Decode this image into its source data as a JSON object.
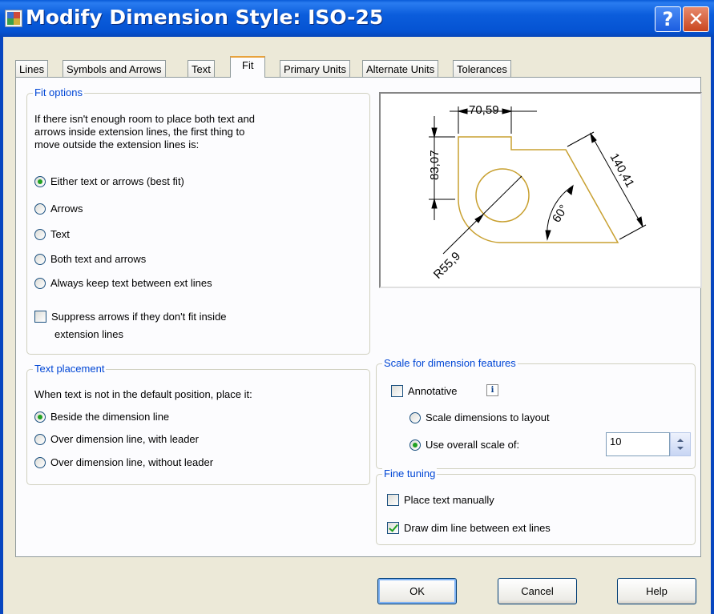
{
  "window": {
    "title": "Modify Dimension Style: ISO-25",
    "help_glyph": "?",
    "close_glyph": "✕"
  },
  "tabs": [
    {
      "label": "Lines"
    },
    {
      "label": "Symbols and Arrows"
    },
    {
      "label": "Text"
    },
    {
      "label": "Fit"
    },
    {
      "label": "Primary Units"
    },
    {
      "label": "Alternate Units"
    },
    {
      "label": "Tolerances"
    }
  ],
  "active_tab": "Fit",
  "fit_options": {
    "legend": "Fit options",
    "description": [
      "If there isn't enough room to place both text and",
      "arrows inside extension lines, the first thing to",
      "move outside the extension lines is:"
    ],
    "options": [
      {
        "label": "Either text or arrows (best fit)",
        "selected": true
      },
      {
        "label": "Arrows",
        "selected": false
      },
      {
        "label": "Text",
        "selected": false
      },
      {
        "label": "Both text and arrows",
        "selected": false
      },
      {
        "label": "Always keep text between ext lines",
        "selected": false
      }
    ],
    "suppress": {
      "line1": "Suppress arrows if they don't fit inside",
      "line2": "extension lines",
      "checked": false
    }
  },
  "text_placement": {
    "legend": "Text placement",
    "description": "When text is not in the default position, place it:",
    "options": [
      {
        "label": "Beside the dimension line",
        "selected": true
      },
      {
        "label": "Over dimension line, with leader",
        "selected": false
      },
      {
        "label": "Over dimension line, without leader",
        "selected": false
      }
    ]
  },
  "preview": {
    "dim_top": "70,59",
    "dim_left": "83,07",
    "dim_diag": "140,41",
    "dim_angle": "60°",
    "dim_radius": "R55,9"
  },
  "scale": {
    "legend": "Scale for dimension features",
    "annotative": {
      "label": "Annotative",
      "checked": false
    },
    "info_glyph": "i",
    "options": [
      {
        "label": "Scale dimensions to layout",
        "selected": false
      },
      {
        "label": "Use overall scale of:",
        "selected": true
      }
    ],
    "overall_value": "10"
  },
  "fine_tuning": {
    "legend": "Fine tuning",
    "place_manually": {
      "label": "Place text manually",
      "checked": false
    },
    "draw_dim_line": {
      "label": "Draw dim line between ext lines",
      "checked": true
    }
  },
  "buttons": {
    "ok": "OK",
    "cancel": "Cancel",
    "help": "Help"
  },
  "colors": {
    "title_blue": "#0553d2",
    "geometry": "#c8a030",
    "legend_blue": "#0046d5",
    "radio_green": "#21a121"
  }
}
